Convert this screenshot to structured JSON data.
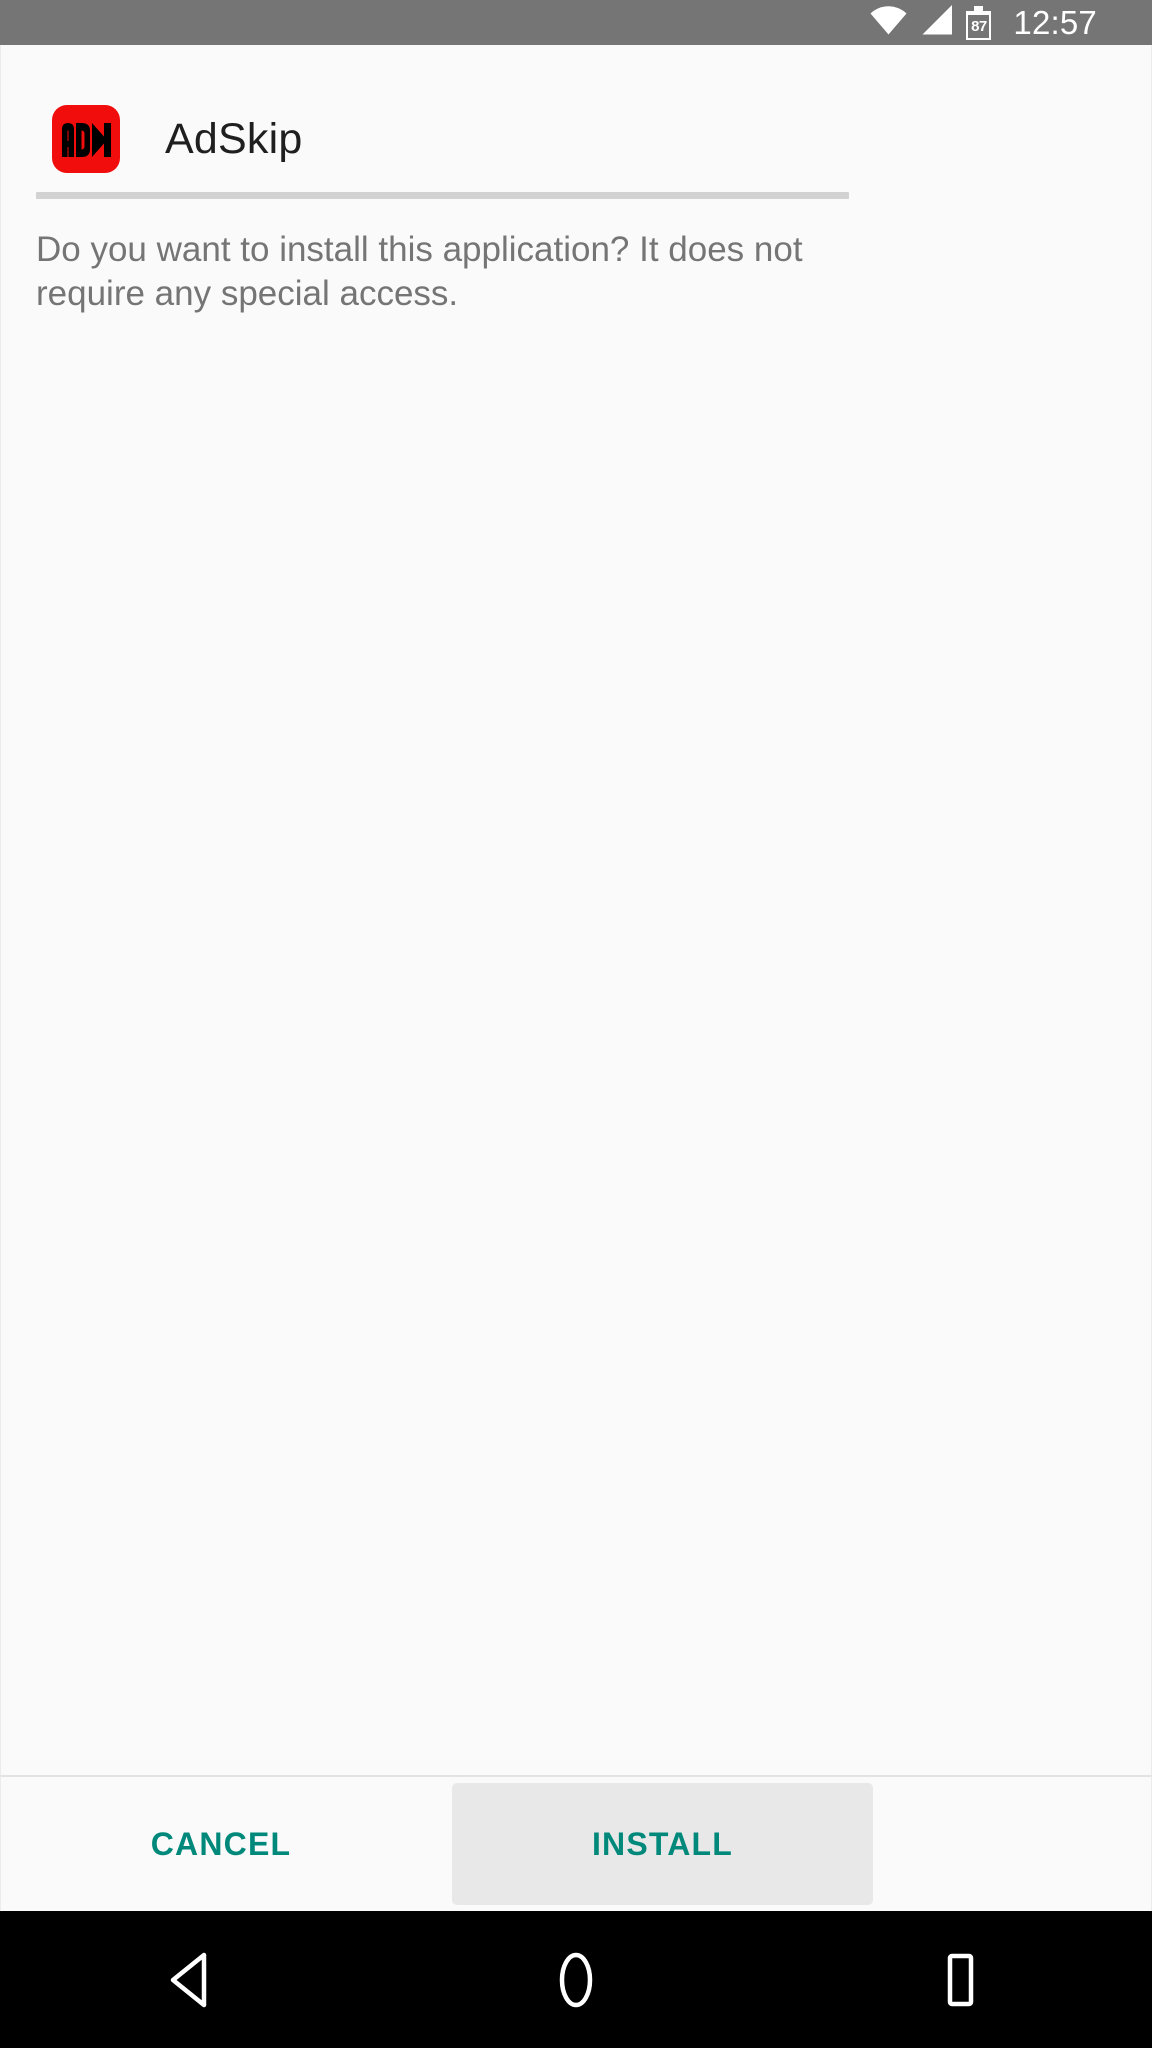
{
  "status_bar": {
    "background_color": "#757575",
    "icon_color": "#ffffff",
    "wifi_icon": "wifi-icon",
    "signal_icon": "cellular-signal-icon",
    "battery_icon": "battery-icon",
    "battery_level": "87",
    "time": "12:57"
  },
  "dialog": {
    "app_icon_name": "adskip-app-icon",
    "app_icon_background": "#f20d0d",
    "app_icon_foreground": "#000000",
    "app_name": "AdSkip",
    "prompt_text": "Do you want to install this application? It does not require any special access.",
    "divider_color": "#d2d2d2",
    "background_color": "#fafafa",
    "prompt_text_color": "#757575",
    "title_color": "#1f1f1f"
  },
  "buttons": {
    "accent_color": "#00897b",
    "cancel_label": "CANCEL",
    "install_label": "INSTALL",
    "install_background": "#e8e8e8"
  },
  "nav_bar": {
    "background_color": "#000000",
    "icon_color": "#ffffff",
    "back_icon": "back-triangle-icon",
    "home_icon": "home-circle-icon",
    "recents_icon": "recents-square-icon"
  }
}
